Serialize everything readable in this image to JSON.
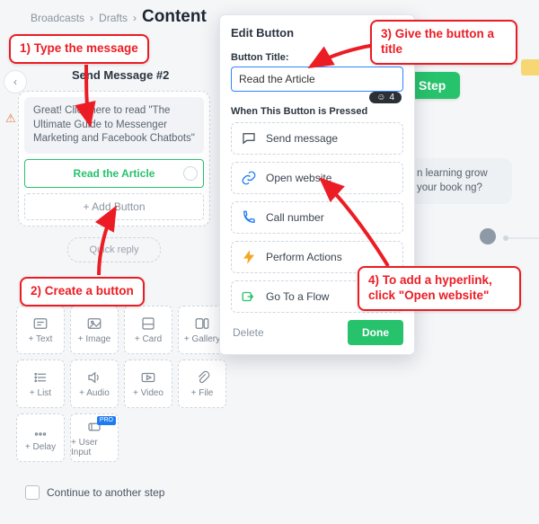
{
  "breadcrumb": {
    "root": "Broadcasts",
    "mid": "Drafts",
    "current": "Content"
  },
  "back_icon": "‹",
  "card": {
    "title": "Send Message #2",
    "text": "Great! Click here to read \"The Ultimate Guide to Messenger Marketing and Facebook Chatbots\"",
    "button_label": "Read the Article",
    "add_button": "+ Add Button",
    "quick_reply": "Quick reply"
  },
  "palette": {
    "r1": [
      "+ Text",
      "+ Image",
      "+ Card",
      "+ Gallery"
    ],
    "r2": [
      "+ List",
      "+ Audio",
      "+ Video",
      "+ File"
    ],
    "r3": [
      "+ Delay",
      "+ User Input"
    ],
    "pro": "PRO"
  },
  "continue_label": "Continue to another step",
  "step_label": "Step",
  "bubble_text": "n learning grow your book ng?",
  "panel": {
    "title": "Edit Button",
    "field_label": "Button Title:",
    "field_value": "Read the Article",
    "smile_count": "4",
    "section": "When This Button is Pressed",
    "opts": [
      "Send message",
      "Open website",
      "Call number",
      "Perform Actions",
      "Go To a Flow"
    ],
    "delete": "Delete",
    "done": "Done"
  },
  "annotations": {
    "a1": "1) Type the message",
    "a2": "2) Create a button",
    "a3": "3) Give the button a title",
    "a4": "4) To add a hyperlink, click \"Open website\""
  }
}
